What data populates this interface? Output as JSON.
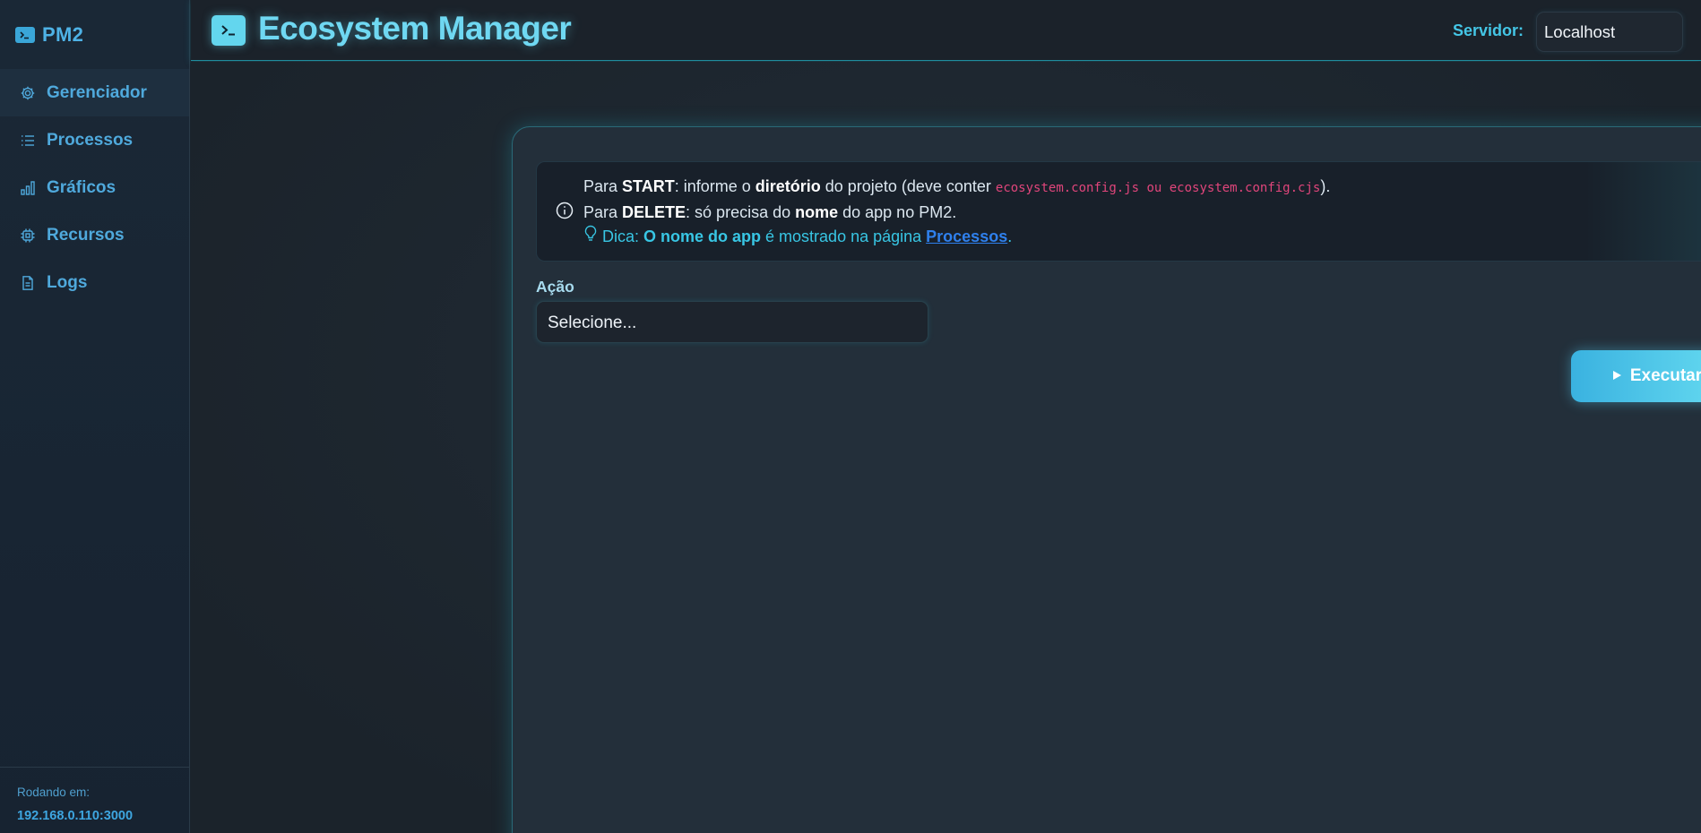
{
  "sidebar": {
    "brand": "PM2",
    "items": [
      {
        "label": "Gerenciador",
        "icon": "gear-icon",
        "active": true
      },
      {
        "label": "Processos",
        "icon": "list-icon",
        "active": false
      },
      {
        "label": "Gráficos",
        "icon": "bar-chart-icon",
        "active": false
      },
      {
        "label": "Recursos",
        "icon": "chip-icon",
        "active": false
      },
      {
        "label": "Logs",
        "icon": "file-icon",
        "active": false
      }
    ],
    "footer_label": "Rodando em:",
    "footer_value": "192.168.0.110:3000"
  },
  "header": {
    "title": "Ecosystem Manager",
    "server_label": "Servidor:",
    "server_value": "Localhost"
  },
  "info": {
    "line1_a": "Para ",
    "line1_b": "START",
    "line1_c": ": informe o ",
    "line1_d": "diretório",
    "line1_e": " do projeto (deve conter ",
    "line1_code": "ecosystem.config.js ou ecosystem.config.cjs",
    "line1_f": ").",
    "line2_a": "Para ",
    "line2_b": "DELETE",
    "line2_c": ": só precisa do ",
    "line2_d": "nome",
    "line2_e": " do app no PM2.",
    "tip_a": "Dica: ",
    "tip_b": "O nome do app",
    "tip_c": " é mostrado na página ",
    "tip_link": "Processos",
    "tip_d": "."
  },
  "form": {
    "action_label": "Ação",
    "action_value": "Selecione...",
    "execute_label": "Executar"
  },
  "colors": {
    "accent": "#63d6ee",
    "sidebar_text": "#4fa9dc",
    "code": "#e0457b",
    "link": "#2f80ed"
  }
}
